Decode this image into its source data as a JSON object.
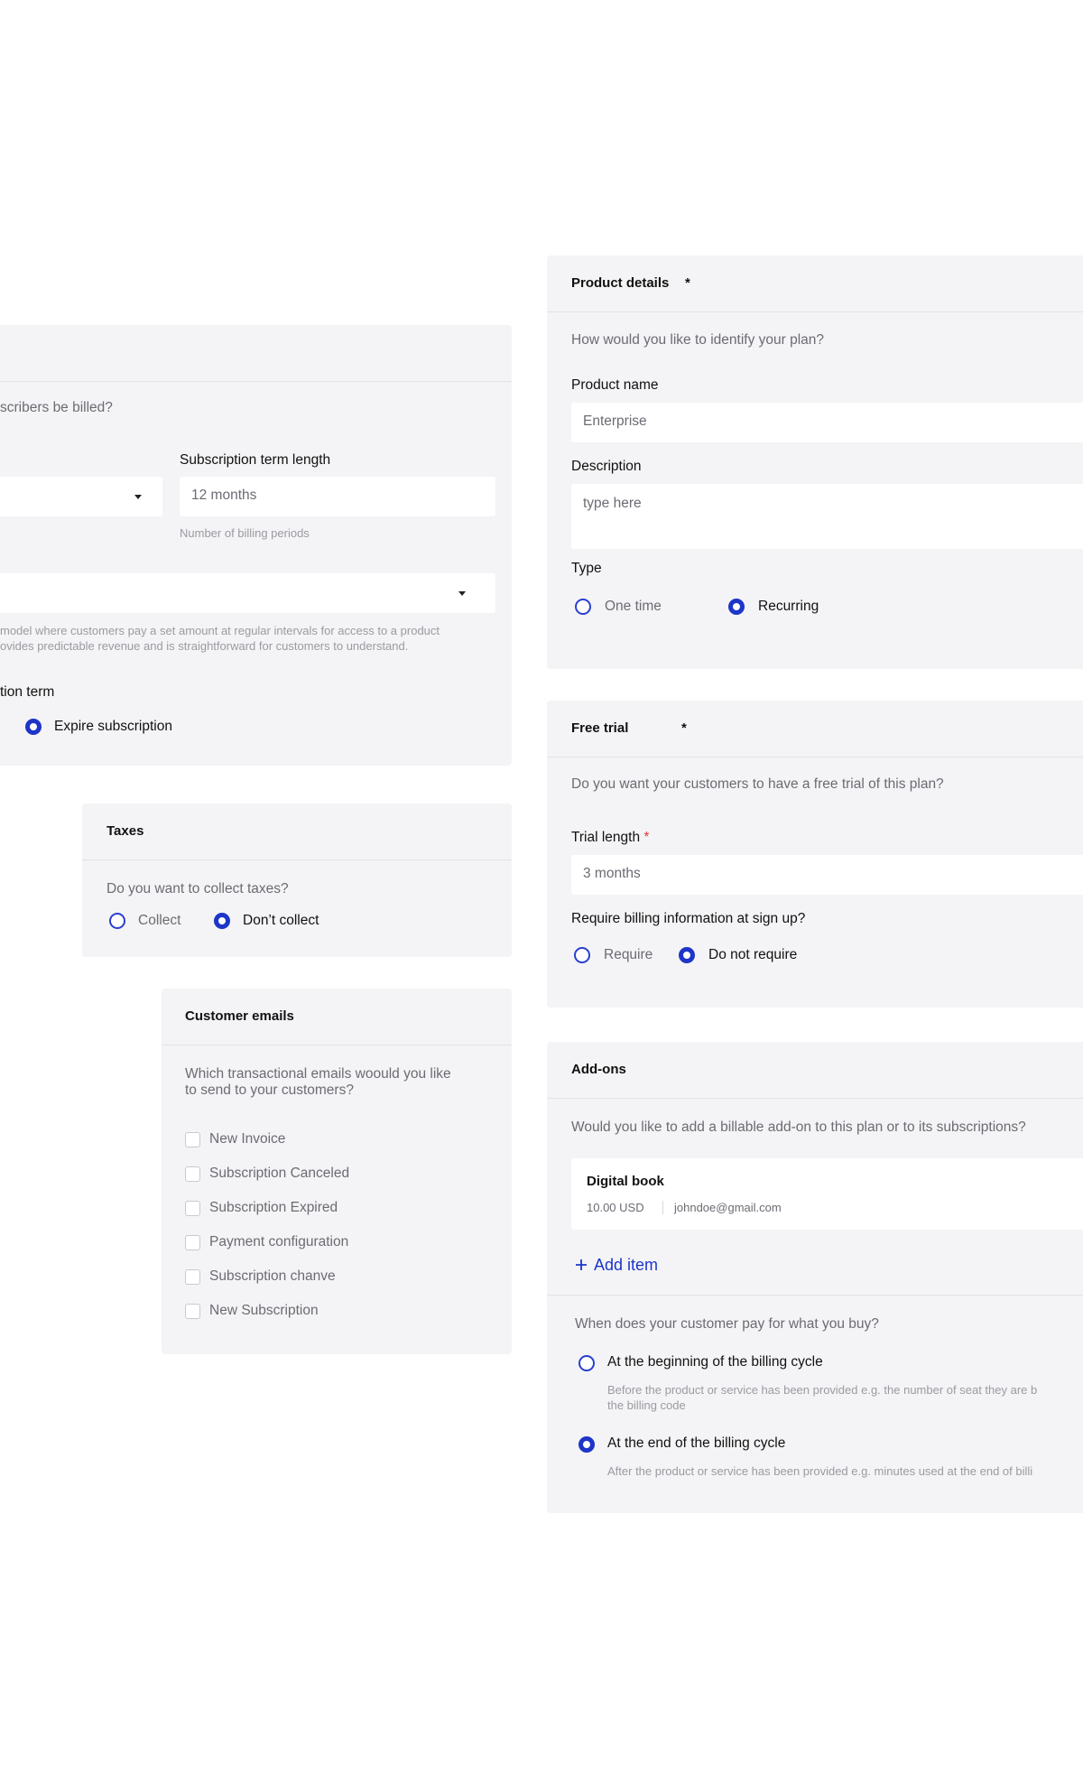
{
  "billing": {
    "question": "scribers be billed?",
    "term_label": "Subscription term length",
    "term_value": "12 months",
    "term_hint": "Number of billing periods",
    "model_hint_line1": "model where customers pay a set amount at regular intervals for access to a product",
    "model_hint_line2": "ovides predictable revenue and is straightforward for customers to understand.",
    "end_label": "tion term",
    "expire_option": "Expire subscription"
  },
  "taxes": {
    "title": "Taxes",
    "question": "Do you want to collect taxes?",
    "option_collect": "Collect",
    "option_dont": "Don’t collect",
    "selected": "Don’t collect"
  },
  "emails": {
    "title": "Customer emails",
    "question_line1": "Which transactional emails woould you like",
    "question_line2": "to send to your customers?",
    "items": [
      {
        "label": "New Invoice",
        "checked": false
      },
      {
        "label": "Subscription Canceled",
        "checked": false
      },
      {
        "label": "Subscription Expired",
        "checked": false
      },
      {
        "label": "Payment configuration",
        "checked": false
      },
      {
        "label": "Subscription chanve",
        "checked": false
      },
      {
        "label": "New Subscription",
        "checked": false
      }
    ]
  },
  "product": {
    "title": "Product details",
    "star": "*",
    "question": "How would you like to identify your plan?",
    "name_label": "Product name",
    "name_value": "Enterprise",
    "desc_label": "Description",
    "desc_placeholder": "type here",
    "type_label": "Type",
    "type_one_time": "One time",
    "type_recurring": "Recurring",
    "type_selected": "Recurring"
  },
  "trial": {
    "title": "Free trial",
    "star": "*",
    "question": "Do you want your customers to have a free trial of this plan?",
    "length_label": "Trial length",
    "length_req": "*",
    "length_value": "3 months",
    "billing_label": "Require billing information at sign up?",
    "option_require": "Require",
    "option_not": "Do not require",
    "selected": "Do not require"
  },
  "addons": {
    "title": "Add-ons",
    "question": "Would you like to add a billable add-on to this plan or to its subscriptions?",
    "item": {
      "name": "Digital book",
      "price": "10.00 USD",
      "email": "johndoe@gmail.com"
    },
    "add_item": "Add item",
    "add_icon": "plus-icon",
    "pay_question": "When does your customer pay for what you buy?",
    "option_beginning": "At the beginning of the billing cycle",
    "beginning_hint_line1": "Before the product or service has been provided e.g. the number of seat they are b",
    "beginning_hint_line2": "the billing code",
    "option_end": "At the end of the billing cycle",
    "end_hint": "After the product or service has been provided e.g. minutes used at the end of billi",
    "selected": "At the end of the billing cycle"
  },
  "colors": {
    "accent": "#1d35c8",
    "panel": "#f4f4f6",
    "required": "#e03a3a"
  }
}
